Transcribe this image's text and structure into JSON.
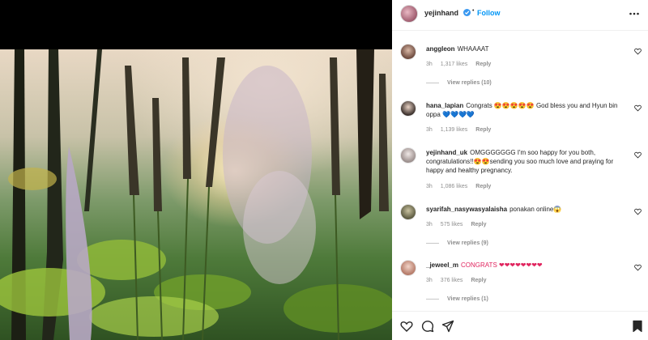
{
  "post": {
    "owner": "yejinhand",
    "verified": true,
    "separator": "•",
    "follow_label": "Follow",
    "more_icon": "more-horizontal-icon"
  },
  "comments": [
    {
      "user": "anggleon",
      "text": "WHAAAAT",
      "time": "3h",
      "likes": "1,317 likes",
      "reply_label": "Reply",
      "view_replies": "View replies (10)"
    },
    {
      "user": "hana_lapian",
      "text": "Congrats 😍😍😍😍😍 God bless you and Hyun bin oppa 💙💙💙💙",
      "time": "3h",
      "likes": "1,139 likes",
      "reply_label": "Reply"
    },
    {
      "user": "yejinhand_uk",
      "text": "OMGGGGGGG I'm soo happy for you both, congratulations!!😍😍sending you soo much love and praying for happy and healthy pregnancy.",
      "time": "3h",
      "likes": "1,086 likes",
      "reply_label": "Reply"
    },
    {
      "user": "syarifah_nasywasyalaisha",
      "text": "ponakan online😱",
      "time": "3h",
      "likes": "575 likes",
      "reply_label": "Reply",
      "view_replies": "View replies (9)"
    },
    {
      "user": "_jeweel_m",
      "text": "CONGRATS ❤❤❤❤❤❤❤❤",
      "time": "3h",
      "likes": "376 likes",
      "reply_label": "Reply",
      "view_replies": "View replies (1)"
    }
  ],
  "actions": [
    "heart-icon",
    "comment-icon",
    "share-icon",
    "bookmark-icon"
  ],
  "colors": {
    "accent": "#0095f6",
    "verified": "#3897f0",
    "text": "#262626",
    "muted": "#8e8e8e"
  }
}
